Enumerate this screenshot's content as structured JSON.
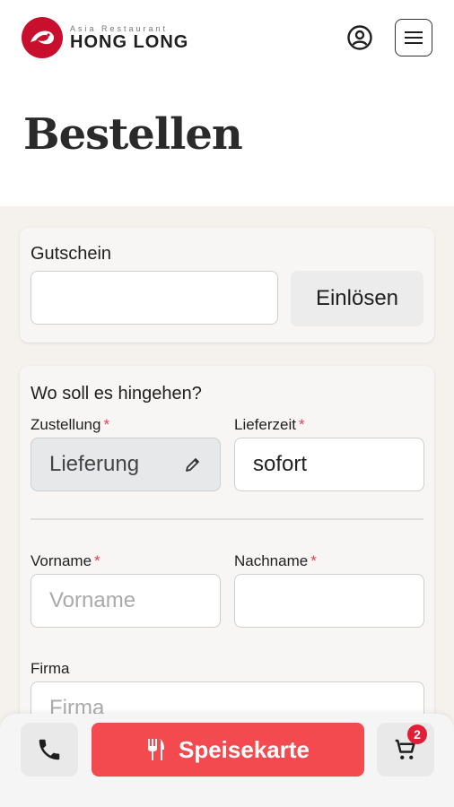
{
  "header": {
    "logo_sub": "Asia Restaurant",
    "logo_main": "HONG LONG",
    "account_icon": "user-circle-icon",
    "menu_icon": "hamburger-icon"
  },
  "page": {
    "title": "Bestellen"
  },
  "voucher": {
    "label": "Gutschein",
    "input_value": "",
    "redeem_label": "Einlösen"
  },
  "delivery": {
    "heading": "Wo soll es hingehen?",
    "zustellung_label": "Zustellung",
    "zustellung_value": "Lieferung",
    "lieferzeit_label": "Lieferzeit",
    "lieferzeit_value": "sofort",
    "required_mark": "*"
  },
  "name": {
    "vorname_label": "Vorname",
    "vorname_placeholder": "Vorname",
    "nachname_label": "Nachname",
    "nachname_value": "",
    "firma_label": "Firma",
    "firma_placeholder": "Firma"
  },
  "bottom_bar": {
    "phone_icon": "phone-icon",
    "menu_label": "Speisekarte",
    "menu_icon": "cutlery-icon",
    "cart_icon": "cart-icon",
    "cart_count": "2"
  },
  "colors": {
    "accent": "#f24a4f",
    "brand": "#c8102e",
    "required": "#e5414b"
  }
}
